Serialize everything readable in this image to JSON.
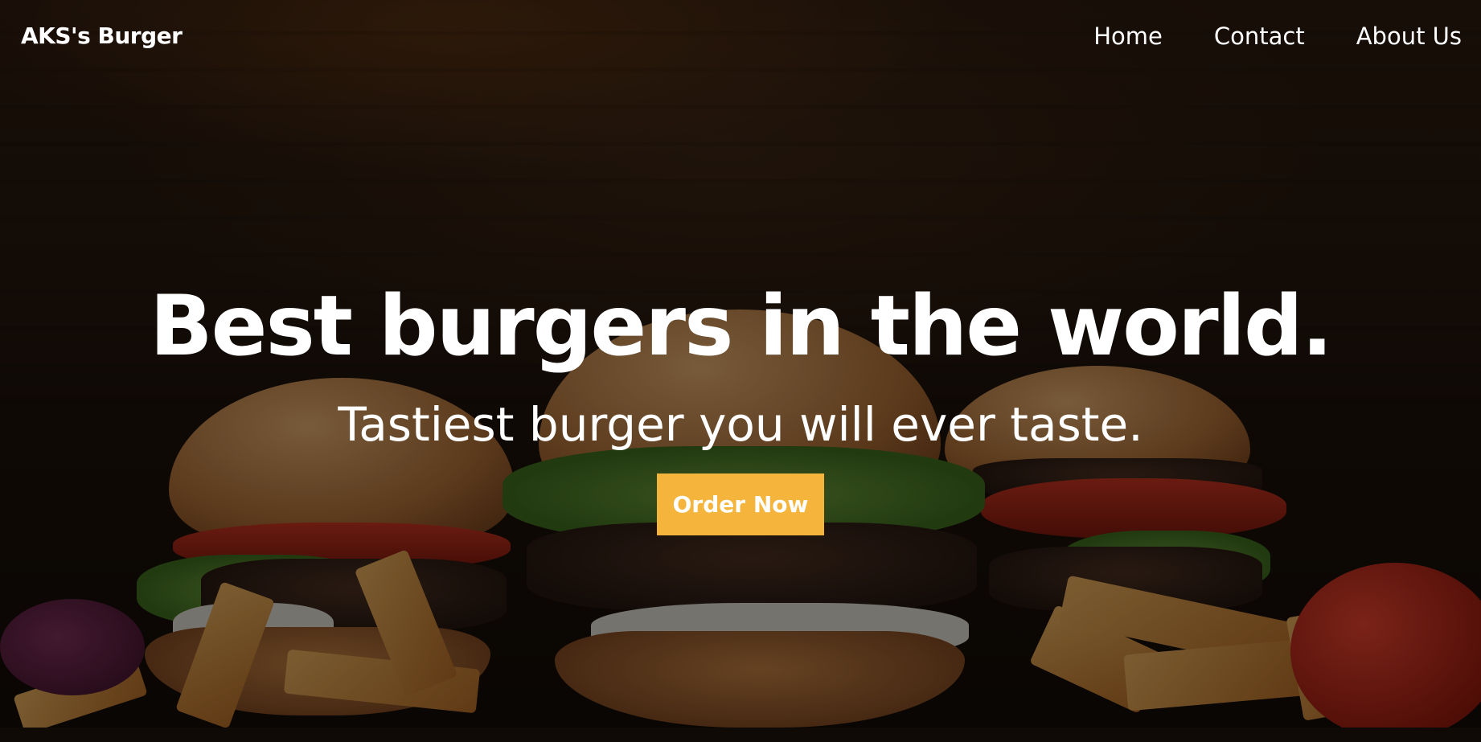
{
  "navbar": {
    "brand": "AKS's Burger",
    "links": [
      {
        "label": "Home"
      },
      {
        "label": "Contact"
      },
      {
        "label": "About Us"
      }
    ]
  },
  "hero": {
    "title": "Best burgers in the world.",
    "subtitle": "Tastiest burger you will ever taste.",
    "cta_label": "Order Now"
  },
  "colors": {
    "accent": "#f5b53d",
    "text": "#ffffff"
  }
}
